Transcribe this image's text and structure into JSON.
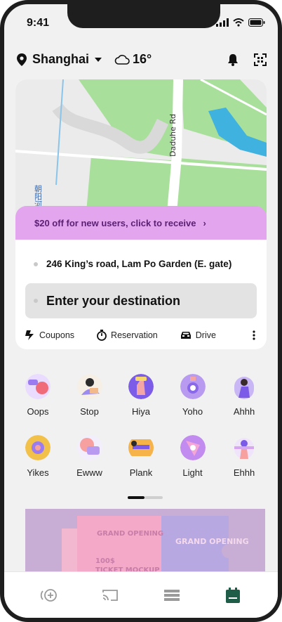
{
  "status": {
    "time": "9:41"
  },
  "header": {
    "city": "Shanghai",
    "temperature": "16°"
  },
  "map": {
    "road_label": "Daduhe Rd",
    "side_label": "朝阳河"
  },
  "promo": {
    "text": "$20 off for new users, click to receive",
    "chevron": "›"
  },
  "pickup": {
    "address": "246 King’s road, Lam Po Garden (E. gate)"
  },
  "destination": {
    "placeholder": "Enter your destination"
  },
  "quick_actions": [
    {
      "label": "Coupons",
      "icon": "coupon-icon"
    },
    {
      "label": "Reservation",
      "icon": "timer-icon"
    },
    {
      "label": "Drive",
      "icon": "car-icon"
    }
  ],
  "services": [
    {
      "label": "Oops",
      "color": "#b89bf0"
    },
    {
      "label": "Stop",
      "color": "#f2b98a"
    },
    {
      "label": "Hiya",
      "color": "#8b6cf0"
    },
    {
      "label": "Yoho",
      "color": "#a58bf0"
    },
    {
      "label": "Ahhh",
      "color": "#9f82ef"
    },
    {
      "label": "Yikes",
      "color": "#f2c14a"
    },
    {
      "label": "Ewww",
      "color": "#f6a0a0"
    },
    {
      "label": "Plank",
      "color": "#f5b34a"
    },
    {
      "label": "Light",
      "color": "#c28bf0"
    },
    {
      "label": "Ehhh",
      "color": "#d6a7ee"
    }
  ],
  "banner": {
    "title_left": "GRAND OPENING",
    "price": "100$",
    "ticket": "TICKET MOCKUP",
    "title_right": "GRAND OPENING"
  },
  "tabs": [
    {
      "name": "home",
      "active": false
    },
    {
      "name": "cast",
      "active": false
    },
    {
      "name": "list",
      "active": false
    },
    {
      "name": "calendar",
      "active": true
    }
  ],
  "colors": {
    "accent": "#1f5d48",
    "promo_bg": "#e3a6ee",
    "promo_text": "#5a1f73"
  }
}
